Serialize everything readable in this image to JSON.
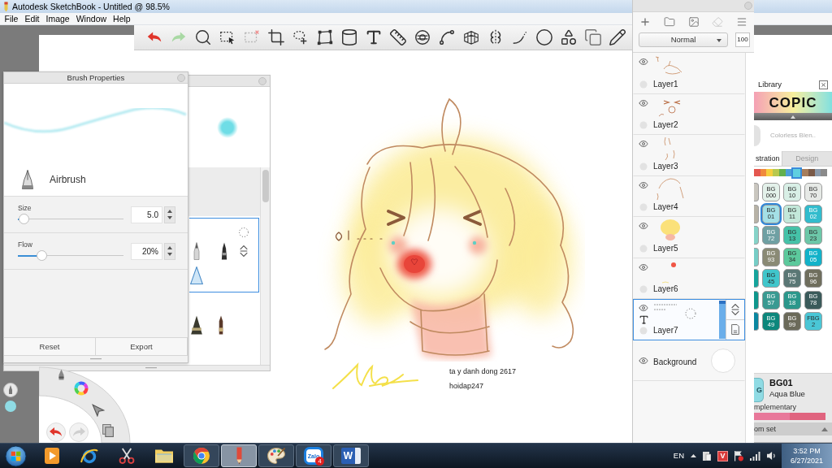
{
  "window": {
    "title": "Autodesk SketchBook - Untitled @ 98.5%"
  },
  "menu": [
    "File",
    "Edit",
    "Image",
    "Window",
    "Help"
  ],
  "brush_properties": {
    "title": "Brush Properties",
    "brush": "Airbrush",
    "settings": [
      {
        "label": "Size",
        "value": "5.0",
        "level": 0.05
      },
      {
        "label": "Flow",
        "value": "20%",
        "level": 0.22
      }
    ],
    "buttons": [
      "Reset",
      "Export"
    ]
  },
  "canvas": {
    "texts": [
      "ta y danh dong 2617",
      "hoidap247"
    ]
  },
  "layers": {
    "blend_mode": "Normal",
    "opacity": "100",
    "items": [
      {
        "name": "Layer1",
        "kind": "paint",
        "visible": true,
        "selected": false
      },
      {
        "name": "Layer2",
        "kind": "paint",
        "visible": true,
        "selected": false
      },
      {
        "name": "Layer3",
        "kind": "paint",
        "visible": true,
        "selected": false
      },
      {
        "name": "Layer4",
        "kind": "paint",
        "visible": true,
        "selected": false
      },
      {
        "name": "Layer5",
        "kind": "paint",
        "visible": true,
        "selected": false
      },
      {
        "name": "Layer6",
        "kind": "paint",
        "visible": true,
        "selected": false
      },
      {
        "name": "Layer7",
        "kind": "text",
        "visible": true,
        "selected": true,
        "level": 1
      },
      {
        "name": "Background",
        "kind": "background",
        "visible": true,
        "selected": false
      }
    ]
  },
  "copic_library": {
    "title": "Library",
    "logo": "COPIC",
    "blender": "Colorless Blen..",
    "tabs": [
      {
        "label": "stration",
        "selected": true
      },
      {
        "label": "Design",
        "selected": false
      }
    ],
    "hues": [
      {
        "color": "#e4574f",
        "selected": false
      },
      {
        "color": "#f08a3c",
        "selected": false
      },
      {
        "color": "#f6cf3e",
        "selected": false
      },
      {
        "color": "#b8c94e",
        "selected": false
      },
      {
        "color": "#62b04d",
        "selected": false
      },
      {
        "color": "#4c9fd8",
        "selected": false
      },
      {
        "color": "#5fcfe0",
        "selected": true
      },
      {
        "color": "#a67d5c",
        "selected": false
      },
      {
        "color": "#7a5a48",
        "selected": false
      },
      {
        "color": "#8b9aab",
        "selected": false
      },
      {
        "color": "#8a8a8a",
        "selected": false
      }
    ],
    "swatches": [
      {
        "kind": "partial",
        "color": "#c9c6bf",
        "selected": false
      },
      {
        "kind": "full",
        "label": "BG 000",
        "color": "#e3f1ea",
        "selected": false
      },
      {
        "kind": "full",
        "label": "BG 10",
        "color": "#d8efe6",
        "selected": false
      },
      {
        "kind": "full",
        "label": "BG 70",
        "color": "#e6e9e6",
        "selected": false
      },
      {
        "kind": "partial",
        "color": "#b7b2a6",
        "selected": false
      },
      {
        "kind": "full",
        "label": "BG 01",
        "color": "#a4e0e6",
        "selected": true
      },
      {
        "kind": "full",
        "label": "BG 11",
        "color": "#c3e8da",
        "selected": false
      },
      {
        "kind": "full",
        "label": "BG 02",
        "color": "#32bccd",
        "selected": false
      },
      {
        "kind": "partial",
        "color": "#86d3c8",
        "selected": false
      },
      {
        "kind": "full",
        "label": "BG 72",
        "color": "#6fa0a3",
        "selected": false
      },
      {
        "kind": "full",
        "label": "BG 13",
        "color": "#45c2a8",
        "selected": false
      },
      {
        "kind": "full",
        "label": "BG 23",
        "color": "#6cc7a8",
        "selected": false
      },
      {
        "kind": "partial",
        "color": "#76cdc6",
        "selected": false
      },
      {
        "kind": "full",
        "label": "BG 93",
        "color": "#8a8a75",
        "selected": false
      },
      {
        "kind": "full",
        "label": "BG 34",
        "color": "#5cc99c",
        "selected": false
      },
      {
        "kind": "full",
        "label": "BG 05",
        "color": "#12b2c9",
        "selected": false
      },
      {
        "kind": "partial",
        "color": "#16a49c",
        "selected": false
      },
      {
        "kind": "full",
        "label": "BG 45",
        "color": "#40c6cb",
        "selected": false
      },
      {
        "kind": "full",
        "label": "BG 75",
        "color": "#5a7775",
        "selected": false
      },
      {
        "kind": "full",
        "label": "BG 96",
        "color": "#6f6e5d",
        "selected": false
      },
      {
        "kind": "partial",
        "color": "#0f968c",
        "selected": false
      },
      {
        "kind": "full",
        "label": "BG 57",
        "color": "#399a92",
        "selected": false
      },
      {
        "kind": "full",
        "label": "BG 18",
        "color": "#2b978b",
        "selected": false
      },
      {
        "kind": "full",
        "label": "BG 78",
        "color": "#3a5a5a",
        "selected": false
      },
      {
        "kind": "partial",
        "color": "#0b87a0",
        "selected": false
      },
      {
        "kind": "full",
        "label": "BG 49",
        "color": "#0c877c",
        "selected": false
      },
      {
        "kind": "full",
        "label": "BG 99",
        "color": "#6b6a5a",
        "selected": false
      },
      {
        "kind": "full",
        "label": "FBG 2",
        "color": "#4ac6d6",
        "selected": false
      }
    ],
    "current": {
      "label_part": "G",
      "code": "BG01",
      "name": "Aqua Blue",
      "color": "#8fdbe4"
    },
    "complementary": "mplementary",
    "complementary_swatches": [
      {
        "color": "#e8789a"
      },
      {
        "color": "#e0647f"
      }
    ],
    "set": "om set"
  },
  "taskbar": {
    "apps": [
      {
        "kind": "media",
        "running": false,
        "active": false
      },
      {
        "kind": "web",
        "running": false,
        "active": false
      },
      {
        "kind": "scissors",
        "running": false,
        "active": false
      },
      {
        "kind": "folder",
        "running": false,
        "active": false
      },
      {
        "kind": "browser",
        "running": true,
        "active": false
      },
      {
        "kind": "pencil",
        "running": true,
        "active": true
      },
      {
        "kind": "palette",
        "running": true,
        "active": false
      },
      {
        "kind": "chat",
        "running": true,
        "active": false,
        "label": "Zalo",
        "badge": "4"
      },
      {
        "kind": "document",
        "running": true,
        "active": false,
        "label": "W"
      }
    ],
    "language": "EN",
    "app_letter": "V",
    "time": "3:52 PM",
    "date": "6/27/2021"
  }
}
